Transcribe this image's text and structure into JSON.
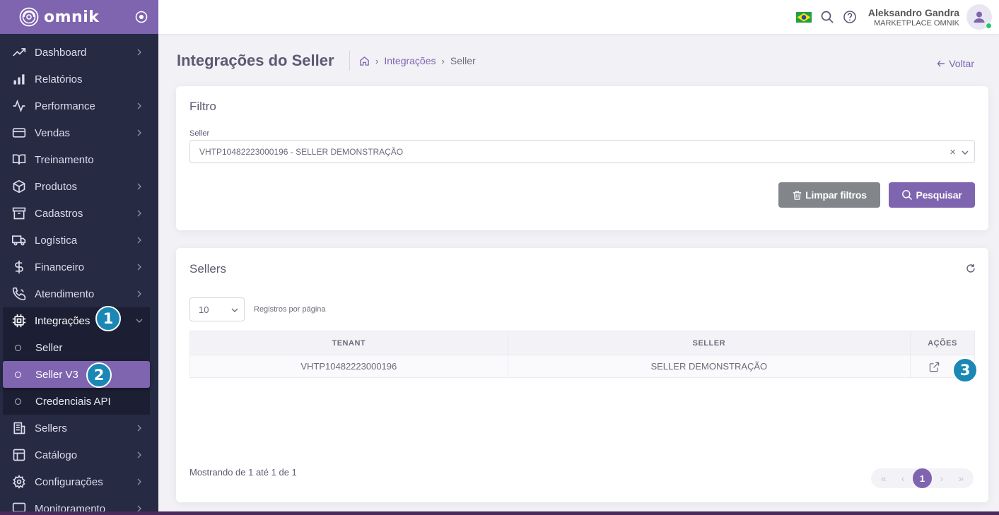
{
  "brand": {
    "name": "omnik"
  },
  "sidebar": {
    "items": [
      {
        "label": "Dashboard",
        "icon": "trending-up-icon",
        "chevron": true
      },
      {
        "label": "Relatórios",
        "icon": "bar-chart-icon",
        "chevron": false
      },
      {
        "label": "Performance",
        "icon": "activity-icon",
        "chevron": true
      },
      {
        "label": "Vendas",
        "icon": "credit-card-icon",
        "chevron": true
      },
      {
        "label": "Treinamento",
        "icon": "book-open-icon",
        "chevron": false
      },
      {
        "label": "Produtos",
        "icon": "box-icon",
        "chevron": true
      },
      {
        "label": "Cadastros",
        "icon": "archive-icon",
        "chevron": true
      },
      {
        "label": "Logística",
        "icon": "truck-icon",
        "chevron": true
      },
      {
        "label": "Financeiro",
        "icon": "dollar-icon",
        "chevron": true
      },
      {
        "label": "Atendimento",
        "icon": "phone-call-icon",
        "chevron": true
      },
      {
        "label": "Integrações",
        "icon": "cpu-icon",
        "chevron": true,
        "open": true
      },
      {
        "label": "Sellers",
        "icon": "building-icon",
        "chevron": true
      },
      {
        "label": "Catálogo",
        "icon": "layout-icon",
        "chevron": true
      },
      {
        "label": "Configurações",
        "icon": "settings-icon",
        "chevron": true
      },
      {
        "label": "Monitoramento",
        "icon": "monitor-icon",
        "chevron": true
      }
    ],
    "integracoes_sub": [
      {
        "label": "Seller",
        "active": false
      },
      {
        "label": "Seller V3",
        "active": true
      },
      {
        "label": "Credenciais API",
        "active": false
      }
    ]
  },
  "badges": [
    "1",
    "2",
    "3"
  ],
  "topbar": {
    "user_name": "Aleksandro Gandra",
    "user_org": "MARKETPLACE OMNIK"
  },
  "header": {
    "title": "Integrações do Seller",
    "breadcrumb": [
      "Integrações",
      "Seller"
    ],
    "back_label": "Voltar"
  },
  "filter": {
    "title": "Filtro",
    "seller_label": "Seller",
    "seller_value": "VHTP10482223000196 - SELLER DEMONSTRAÇÃO",
    "clear_label": "Limpar filtros",
    "search_label": "Pesquisar"
  },
  "sellers": {
    "title": "Sellers",
    "per_page_value": "10",
    "per_page_label": "Registros por página",
    "columns": [
      "TENANT",
      "SELLER",
      "AÇÕES"
    ],
    "rows": [
      {
        "tenant": "VHTP10482223000196",
        "seller": "SELLER DEMONSTRAÇÃO"
      }
    ],
    "showing": "Mostrando de 1 até 1 de 1",
    "pager": {
      "first": "«",
      "prev": "‹",
      "current": "1",
      "next": "›",
      "last": "»"
    }
  },
  "colors": {
    "accent": "#7f64b0",
    "sidebar_bg": "#262a43",
    "badge": "#1a87b5"
  }
}
